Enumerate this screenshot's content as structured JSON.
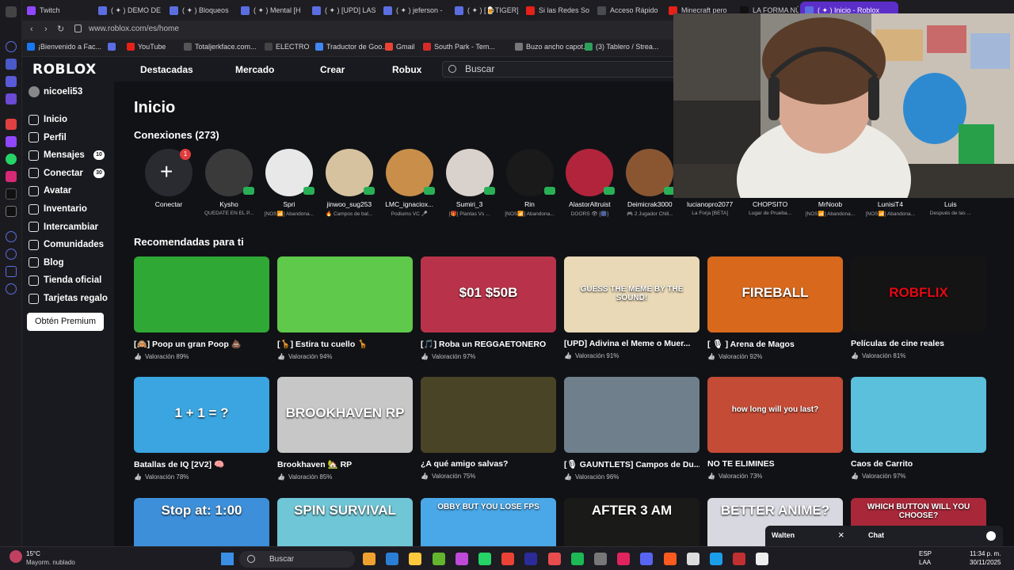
{
  "browser": {
    "tabs": [
      {
        "label": "Twitch",
        "color": "#9146ff"
      },
      {
        "label": "( ✦ ) DEMO DE",
        "color": "#5b6ee1"
      },
      {
        "label": "( ✦ ) Bloqueos",
        "color": "#5b6ee1"
      },
      {
        "label": "( ✦ ) Mental [H",
        "color": "#5b6ee1"
      },
      {
        "label": "( ✦ ) [UPD] LAS",
        "color": "#5b6ee1"
      },
      {
        "label": "( ✦ ) jeferson -",
        "color": "#5b6ee1"
      },
      {
        "label": "( ✦ ) [🍺TIGER]",
        "color": "#5b6ee1"
      },
      {
        "label": "Si las Redes So",
        "color": "#e62117"
      },
      {
        "label": "Acceso Rápido",
        "color": "#4a4a52"
      },
      {
        "label": "Minecraft pero",
        "color": "#e62117"
      },
      {
        "label": "LA FORMA NÚ",
        "color": "#111111"
      },
      {
        "label": "( ✦ ) Inicio - Roblox",
        "color": "#5b6ee1"
      }
    ],
    "url": "www.roblox.com/es/home",
    "bookmarks": [
      {
        "label": "¡Bienvenido a Fac...",
        "color": "#1877f2"
      },
      {
        "label": "",
        "color": "#5b6ee1"
      },
      {
        "label": "YouTube",
        "color": "#e62117"
      },
      {
        "label": "Totaljerkface.com...",
        "color": "#555"
      },
      {
        "label": "ELECTRO",
        "color": "#444"
      },
      {
        "label": "Traductor de Goo...",
        "color": "#4285f4"
      },
      {
        "label": "Gmail",
        "color": "#ea4335"
      },
      {
        "label": "South Park - Tem...",
        "color": "#d62b2b"
      },
      {
        "label": "Buzo ancho capot...",
        "color": "#777"
      },
      {
        "label": "(3) Tablero / Strea...",
        "color": "#2e9e5b"
      }
    ]
  },
  "roblox": {
    "logo": "ROBLOX",
    "nav": [
      "Destacadas",
      "Mercado",
      "Crear",
      "Robux"
    ],
    "search_placeholder": "Buscar",
    "username": "nicoeli53",
    "sidebar": [
      {
        "label": "Inicio",
        "badge": ""
      },
      {
        "label": "Perfil",
        "badge": ""
      },
      {
        "label": "Mensajes",
        "badge": "10"
      },
      {
        "label": "Conectar",
        "badge": "30"
      },
      {
        "label": "Avatar",
        "badge": ""
      },
      {
        "label": "Inventario",
        "badge": ""
      },
      {
        "label": "Intercambiar",
        "badge": ""
      },
      {
        "label": "Comunidades",
        "badge": ""
      },
      {
        "label": "Blog",
        "badge": ""
      },
      {
        "label": "Tienda oficial",
        "badge": ""
      },
      {
        "label": "Tarjetas regalo",
        "badge": ""
      }
    ],
    "premium_button": "Obtén Premium",
    "page_title": "Inicio",
    "connections_title": "Conexiones (273)",
    "connect_label": "Conectar",
    "connect_badge": "1",
    "connections": [
      {
        "name": "Kysho",
        "status": "QUÉDATE EN EL P...",
        "color": "#3a3a3a"
      },
      {
        "name": "Spri",
        "status": "[NOS📶] Abandona...",
        "color": "#e8e8e8"
      },
      {
        "name": "jinwoo_sug253",
        "status": "🔥 Campos de bat...",
        "color": "#d7c29f"
      },
      {
        "name": "LMC_ignaciox...",
        "status": "Podiums VC 🎤",
        "color": "#c88e4a"
      },
      {
        "name": "Sumiri_3",
        "status": "[🎁] Plantas Vs ...",
        "color": "#d9d2cc"
      },
      {
        "name": "Rin",
        "status": "[NOS📶] Abandona...",
        "color": "#1a1a1a"
      },
      {
        "name": "AlastorAltruist",
        "status": "DOORS 👁 [🎆]",
        "color": "#b2243c"
      },
      {
        "name": "Deimicrak3000",
        "status": "🎮 2 Jugador Chill...",
        "color": "#8a5632"
      },
      {
        "name": "lucianopro2077",
        "status": "La Forja [BETA]",
        "color": "#4a4a4a"
      },
      {
        "name": "CHOPSITO",
        "status": "Lugar de Prueba...",
        "color": "#5a5a5a"
      },
      {
        "name": "MrNoob",
        "status": "[NOS📶] Abandona...",
        "color": "#6a6a6a"
      },
      {
        "name": "LunisiT4",
        "status": "[NOS📶] Abandona...",
        "color": "#7a7a7a"
      },
      {
        "name": "Luis",
        "status": "Después de las ...",
        "color": "#888"
      }
    ],
    "recommended_title": "Recomendadas para ti",
    "games_row1": [
      {
        "title": "[🙈] Poop un gran Poop 💩",
        "rating": "Valoración 89%",
        "bg": "#2fa836",
        "overlay": ""
      },
      {
        "title": "[🦒] Estira tu cuello 🦒",
        "rating": "Valoración 94%",
        "bg": "#5ec94a",
        "overlay": ""
      },
      {
        "title": "[🎵] Roba un REGGAETONERO",
        "rating": "Valoración 97%",
        "bg": "#b8334a",
        "overlay": "$01  $50B"
      },
      {
        "title": "[UPD] Adivina el Meme o Muer...",
        "rating": "Valoración 91%",
        "bg": "#e9d9b6",
        "overlay": "GUESS THE MEME BY THE SOUND!"
      },
      {
        "title": "[ 🎙 ] Arena de Magos",
        "rating": "Valoración 92%",
        "bg": "#d8691c",
        "overlay": "FIREBALL"
      },
      {
        "title": "Películas de cine reales",
        "rating": "Valoración 81%",
        "bg": "#141414",
        "overlay": "ROBFLIX"
      }
    ],
    "games_row2": [
      {
        "title": "Batallas de IQ [2V2] 🧠",
        "rating": "Valoración 78%",
        "bg": "#3aa5e0",
        "overlay": "1 + 1 = ?"
      },
      {
        "title": "Brookhaven 🏡 RP",
        "rating": "Valoración 85%",
        "bg": "#c7c7c7",
        "overlay": "BROOKHAVEN RP"
      },
      {
        "title": "¿A qué amigo salvas?",
        "rating": "Valoración 75%",
        "bg": "#4a4426",
        "overlay": ""
      },
      {
        "title": "[🎙 GAUNTLETS] Campos de Du...",
        "rating": "Valoración 96%",
        "bg": "#6f7f8c",
        "overlay": ""
      },
      {
        "title": "NO TE ELIMINES",
        "rating": "Valoración 73%",
        "bg": "#c44b36",
        "overlay": "how long will you last?"
      },
      {
        "title": "Caos de Carrito",
        "rating": "Valoración 97%",
        "bg": "#5ac0dc",
        "overlay": ""
      }
    ],
    "games_row3": [
      {
        "bg": "#3c8fd8",
        "overlay": "Stop at: 1:00"
      },
      {
        "bg": "#6fc6d6",
        "overlay": "SPIN SURVIVAL"
      },
      {
        "bg": "#4aa8e8",
        "overlay": "OBBY BUT YOU LOSE FPS"
      },
      {
        "bg": "#1a1a18",
        "overlay": "AFTER 3 AM"
      },
      {
        "bg": "#d8d8e0",
        "overlay": "BETTER ANIME?"
      },
      {
        "bg": "#a8283a",
        "overlay": "WHICH BUTTON WILL YOU CHOOSE?"
      }
    ],
    "chat_label": "Chat",
    "walten_label": "Walten"
  },
  "taskbar": {
    "weather_temp": "15°C",
    "weather_desc": "Mayorm. nublado",
    "search": "Buscar",
    "lang1": "ESP",
    "lang2": "LAA",
    "time": "11:34 p. m.",
    "date": "30/11/2025",
    "icon_colors": [
      "#f0a030",
      "#2a7fd4",
      "#ffc83d",
      "#62b52d",
      "#c04ad8",
      "#25d366",
      "#ea4335",
      "#2b2b9a",
      "#e84d4d",
      "#1db954",
      "#777",
      "#e0245e",
      "#5865f2",
      "#ff5a1f",
      "#ddd",
      "#1b9ee8",
      "#c03030",
      "#eee"
    ]
  }
}
